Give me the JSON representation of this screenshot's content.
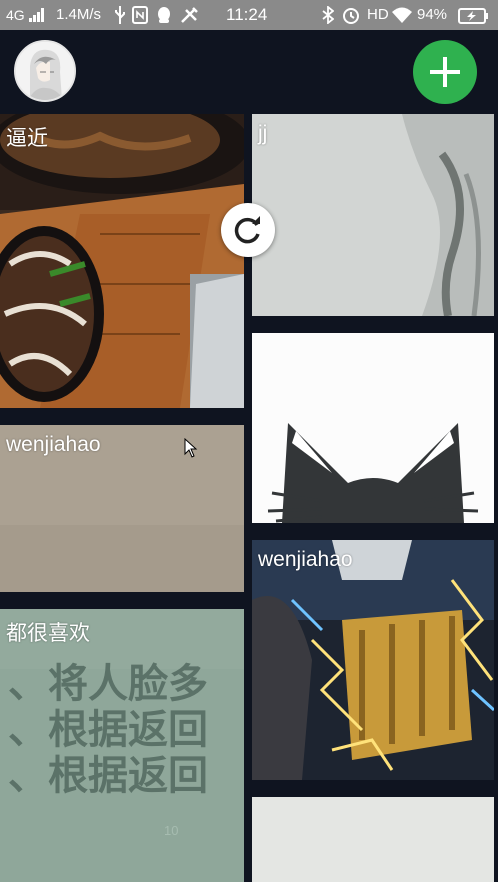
{
  "status_bar": {
    "network": "4G",
    "speed": "1.4M/s",
    "time": "11:24",
    "hd": "HD",
    "battery_percent": "94%",
    "icons": [
      "signal-icon",
      "usb-icon",
      "nfc-icon",
      "qq-icon",
      "tools-icon",
      "bluetooth-icon",
      "alarm-icon",
      "wifi-icon",
      "battery-charging-icon"
    ]
  },
  "header": {
    "avatar_icon": "avatar-icon",
    "add_icon": "plus-icon",
    "accent": "#2fb14f"
  },
  "feed": {
    "cards": [
      {
        "label": "逼近",
        "image": "food-plate-image"
      },
      {
        "label": "jj",
        "image": "grey-abstract-image"
      },
      {
        "label": "",
        "image": "cat-ears-drawing-image"
      },
      {
        "label": "wenjiahao",
        "image": "beige-texture-image"
      },
      {
        "label": "wenjiahao",
        "image": "golden-fist-lightning-image"
      },
      {
        "label": "都很喜欢",
        "image": "chinese-text-paper-image"
      },
      {
        "label": "",
        "image": "blank-grey-image"
      }
    ],
    "paper_text": [
      "、将人脸多",
      "、根据返回",
      "、根据返回"
    ],
    "paper_page_number": "10",
    "refresh_icon": "refresh-icon"
  }
}
